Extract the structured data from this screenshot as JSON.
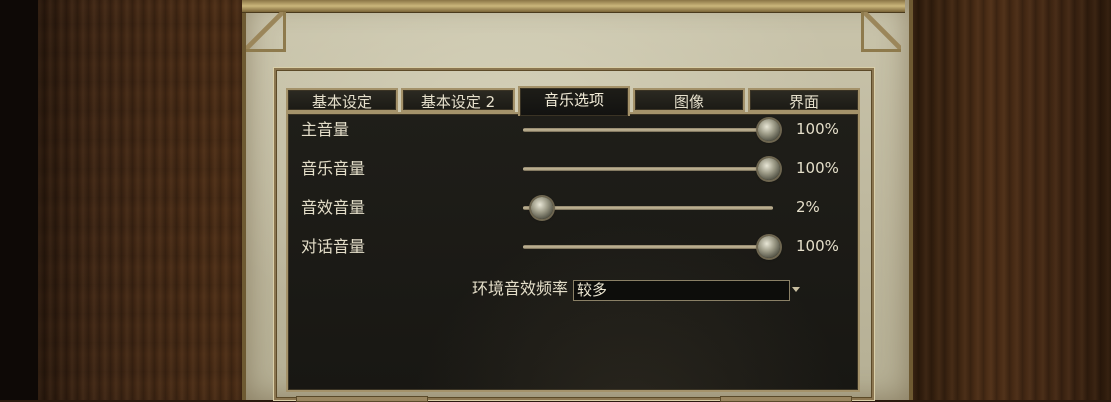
{
  "tabs": [
    {
      "label": "基本设定"
    },
    {
      "label": "基本设定 2"
    },
    {
      "label": "音乐选项"
    },
    {
      "label": "图像"
    },
    {
      "label": "界面"
    }
  ],
  "active_tab": "音乐选项",
  "sliders": [
    {
      "label": "主音量",
      "value_text": "100%",
      "value": 100
    },
    {
      "label": "音乐音量",
      "value_text": "100%",
      "value": 100
    },
    {
      "label": "音效音量",
      "value_text": "2%",
      "value": 2
    },
    {
      "label": "对话音量",
      "value_text": "100%",
      "value": 100
    }
  ],
  "ambient": {
    "label": "环境音效频率",
    "selected": "较多"
  }
}
